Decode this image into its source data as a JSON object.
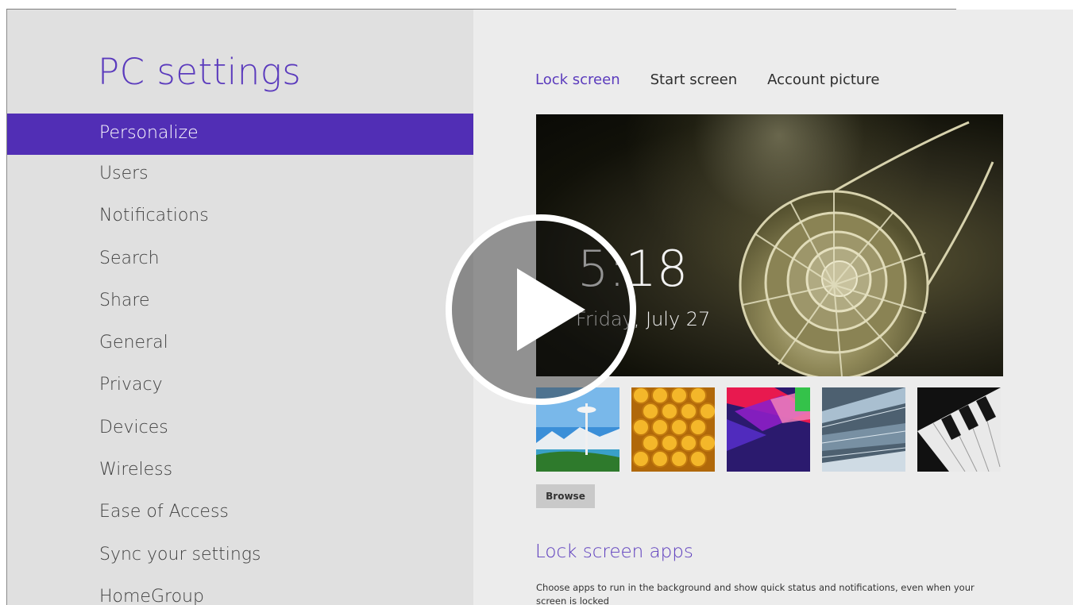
{
  "header": {
    "title": "PC settings"
  },
  "sidebar": {
    "items": [
      {
        "label": "Personalize"
      },
      {
        "label": "Users"
      },
      {
        "label": "Notifications"
      },
      {
        "label": "Search"
      },
      {
        "label": "Share"
      },
      {
        "label": "General"
      },
      {
        "label": "Privacy"
      },
      {
        "label": "Devices"
      },
      {
        "label": "Wireless"
      },
      {
        "label": "Ease of Access"
      },
      {
        "label": "Sync your settings"
      },
      {
        "label": "HomeGroup"
      }
    ],
    "active_index": 0
  },
  "tabs": [
    {
      "label": "Lock screen"
    },
    {
      "label": "Start screen"
    },
    {
      "label": "Account picture"
    }
  ],
  "preview": {
    "time": "5:18",
    "date": "Friday, July 27"
  },
  "thumbnails": [
    {
      "name": "space-needle-thumbnail"
    },
    {
      "name": "honeycomb-thumbnail"
    },
    {
      "name": "color-blocks-thumbnail"
    },
    {
      "name": "escalator-thumbnail"
    },
    {
      "name": "piano-keys-thumbnail"
    }
  ],
  "browse_label": "Browse",
  "lock_screen_apps": {
    "title": "Lock screen apps",
    "description": "Choose apps to run in the background and show quick status and notifications, even when your screen is locked"
  },
  "colors": {
    "accent": "#512eb5",
    "title": "#5b3bbd",
    "sidebar_bg": "#e0e0e0",
    "content_bg": "#ececec"
  },
  "icons": {
    "video_overlay": "play-icon"
  }
}
